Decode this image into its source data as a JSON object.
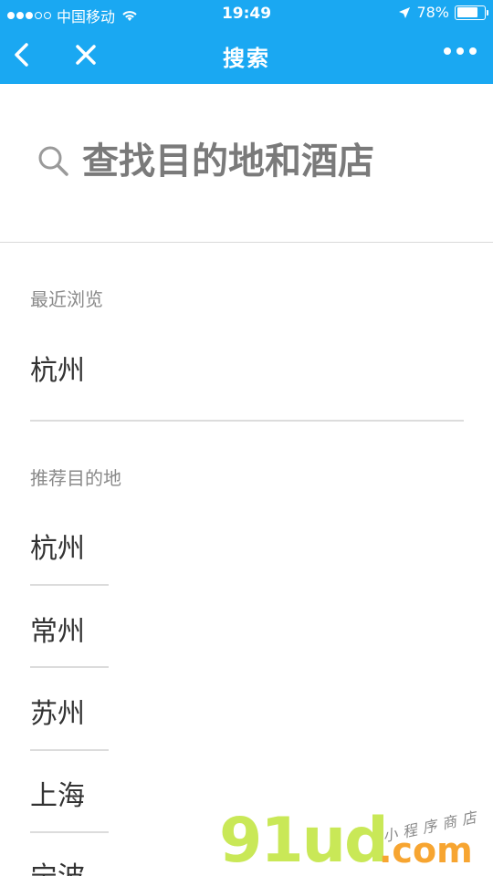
{
  "status_bar": {
    "carrier": "中国移动",
    "time": "19:49",
    "battery_percent": "78%",
    "battery_level": 0.78
  },
  "nav": {
    "title": "搜索",
    "back_icon": "chevron-left-icon",
    "close_icon": "close-icon",
    "more_icon": "more-dots-icon"
  },
  "search": {
    "placeholder": "查找目的地和酒店",
    "value": ""
  },
  "recent": {
    "title": "最近浏览",
    "items": [
      "杭州"
    ]
  },
  "recommended": {
    "title": "推荐目的地",
    "items": [
      "杭州",
      "常州",
      "苏州",
      "上海",
      "宁波"
    ]
  },
  "watermark": {
    "brand": "91ud",
    "suffix": ".com",
    "tagline": "小程序商店"
  },
  "colors": {
    "header_bg": "#1aa8f2",
    "text_primary": "#333333",
    "text_secondary": "#8a8a8a",
    "divider": "#dcdcdc"
  }
}
